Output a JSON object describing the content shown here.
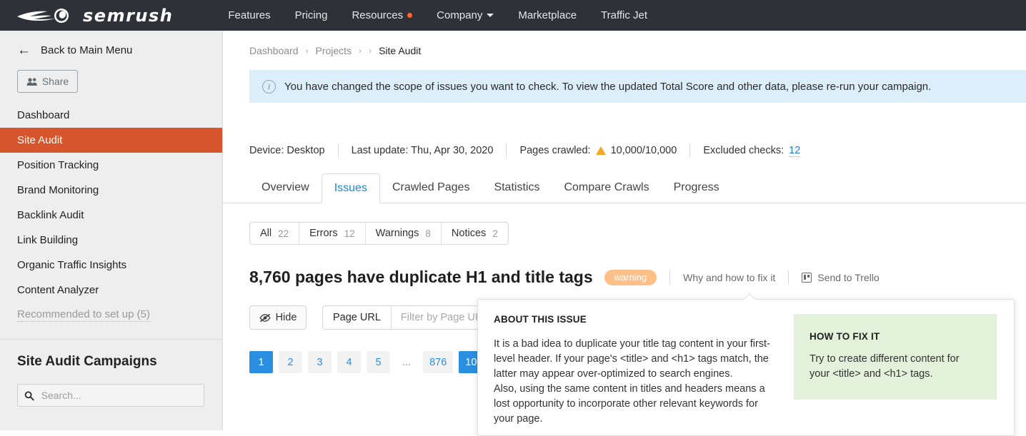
{
  "topnav": {
    "brand": "semrush",
    "brand_icon": "semrush-flame-logo",
    "items": [
      {
        "label": "Features",
        "badge": null,
        "caret": false
      },
      {
        "label": "Pricing",
        "badge": null,
        "caret": false
      },
      {
        "label": "Resources",
        "badge": "orange-dot",
        "caret": false
      },
      {
        "label": "Company",
        "badge": null,
        "caret": true
      },
      {
        "label": "Marketplace",
        "badge": null,
        "caret": false
      },
      {
        "label": "Traffic Jet",
        "badge": null,
        "caret": false
      }
    ]
  },
  "sidebar": {
    "back_label": "Back to Main Menu",
    "back_icon": "arrow-left-icon",
    "share_label": "Share",
    "share_icon": "people-icon",
    "items": [
      {
        "label": "Dashboard",
        "state": "normal"
      },
      {
        "label": "Site Audit",
        "state": "active"
      },
      {
        "label": "Position Tracking",
        "state": "normal"
      },
      {
        "label": "Brand Monitoring",
        "state": "normal"
      },
      {
        "label": "Backlink Audit",
        "state": "normal"
      },
      {
        "label": "Link Building",
        "state": "normal"
      },
      {
        "label": "Organic Traffic Insights",
        "state": "normal"
      },
      {
        "label": "Content Analyzer",
        "state": "normal"
      },
      {
        "label": "Recommended to set up (5)",
        "state": "muted"
      }
    ],
    "campaigns_title": "Site Audit Campaigns",
    "search_placeholder": "Search...",
    "search_value": "",
    "search_icon": "search-icon",
    "active_color": "#d7552c"
  },
  "breadcrumb": {
    "items": [
      "Dashboard",
      "Projects",
      ""
    ],
    "current": "Site Audit",
    "separator": "›"
  },
  "notice": {
    "icon": "info-circle-icon",
    "text": "You have changed the scope of issues you want to check. To view the updated Total Score and other data, please re-run your campaign.",
    "background": "#ddeefb"
  },
  "status": {
    "device_label": "Device: Desktop",
    "last_update_label": "Last update: Thu, Apr 30, 2020",
    "pages_crawled_label": "Pages crawled:",
    "pages_crawled_value": "10,000/10,000",
    "pages_crawled_icon": "warning-triangle-icon",
    "excluded_label": "Excluded checks:",
    "excluded_value": "12"
  },
  "tabs": [
    {
      "label": "Overview",
      "active": false
    },
    {
      "label": "Issues",
      "active": true
    },
    {
      "label": "Crawled Pages",
      "active": false
    },
    {
      "label": "Statistics",
      "active": false
    },
    {
      "label": "Compare Crawls",
      "active": false
    },
    {
      "label": "Progress",
      "active": false
    }
  ],
  "filters": [
    {
      "label": "All",
      "count": "22"
    },
    {
      "label": "Errors",
      "count": "12"
    },
    {
      "label": "Warnings",
      "count": "8"
    },
    {
      "label": "Notices",
      "count": "2"
    }
  ],
  "issue": {
    "title": "8,760 pages have duplicate H1 and title tags",
    "badge": "warning",
    "badge_color": "#ffc087",
    "why_link": "Why and how to fix it",
    "trello_link": "Send to Trello",
    "trello_icon": "trello-icon"
  },
  "toolbar": {
    "hide_label": "Hide",
    "hide_icon": "eye-slash-icon",
    "filter_label": "Page URL",
    "filter_placeholder": "Filter by Page URL",
    "filter_value": ""
  },
  "pagination": {
    "pages": [
      "1",
      "2",
      "3",
      "4",
      "5",
      "...",
      "876",
      "10"
    ],
    "active_index": 0,
    "second_active_index": 7,
    "active_color": "#2a8fe0"
  },
  "popover": {
    "about_heading": "ABOUT THIS ISSUE",
    "about_paragraph_1": "It is a bad idea to duplicate your title tag content in your first-level header. If your page's <title> and <h1> tags match, the latter may appear over-optimized to search engines.",
    "about_paragraph_2": "Also, using the same content in titles and headers means a lost opportunity to incorporate other relevant keywords for your page.",
    "fix_heading": "HOW TO FIX IT",
    "fix_text": "Try to create different content for your <title> and <h1> tags.",
    "fix_background": "#e3f0da"
  }
}
